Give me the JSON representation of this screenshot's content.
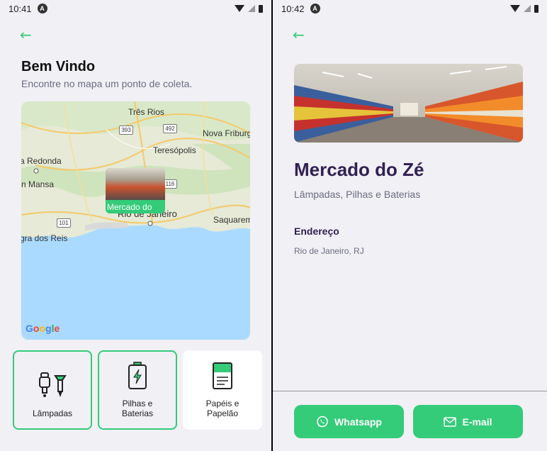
{
  "left_screen": {
    "status": {
      "time": "10:41",
      "notif": "A"
    },
    "title": "Bem Vindo",
    "subtitle": "Encontre no mapa um ponto de coleta.",
    "map": {
      "labels": [
        "Três Rios",
        "Nova Friburg",
        "Teresópolis",
        "a Redonda",
        "n Mansa",
        "Rio de Janeiro",
        "Saquarem",
        "gra dos Reis"
      ],
      "shields": [
        "393",
        "492",
        "116",
        "101"
      ],
      "attribution": "Google"
    },
    "marker_label": "Mercado do",
    "items": [
      {
        "name": "Lâmpadas",
        "selected": true,
        "icon": "lamp-icon"
      },
      {
        "name": "Pilhas e\nBaterias",
        "selected": true,
        "icon": "battery-icon"
      },
      {
        "name": "Papéis e\nPapelão",
        "selected": false,
        "icon": "paper-icon"
      }
    ]
  },
  "right_screen": {
    "status": {
      "time": "10:42",
      "notif": "A"
    },
    "point_name": "Mercado do Zé",
    "point_items": "Lâmpadas, Pilhas e Baterias",
    "address_title": "Endereço",
    "address_value": "Rio de Janeiro, RJ",
    "whatsapp_label": "Whatsapp",
    "email_label": "E-mail"
  },
  "colors": {
    "accent": "#34cb79",
    "title": "#322153",
    "muted": "#6c6c80"
  }
}
